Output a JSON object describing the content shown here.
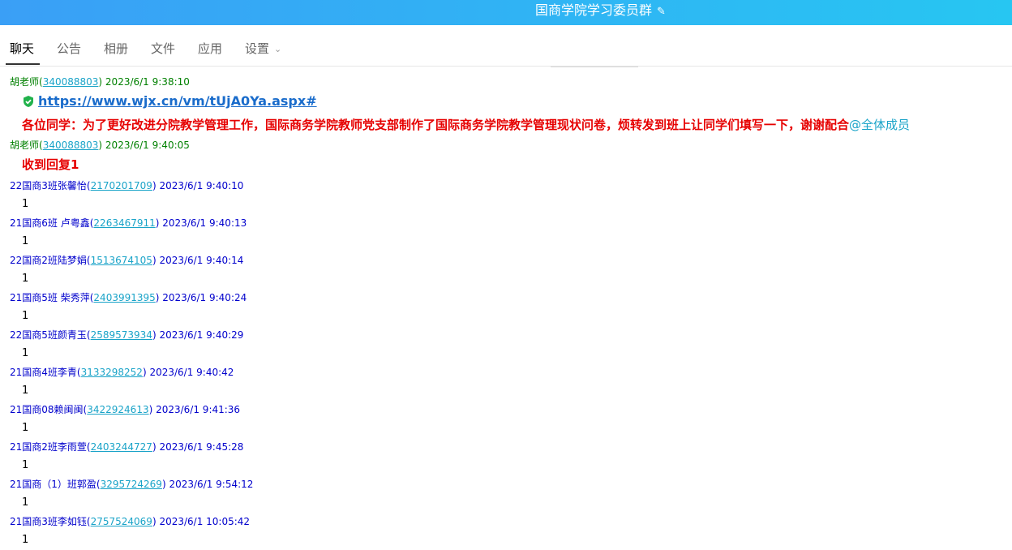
{
  "window": {
    "title": "国商学院学习委员群",
    "edit_icon": "✎"
  },
  "tabs": [
    {
      "label": "聊天"
    },
    {
      "label": "公告"
    },
    {
      "label": "相册"
    },
    {
      "label": "文件"
    },
    {
      "label": "应用"
    },
    {
      "label": "设置",
      "chevron": "⌄"
    }
  ],
  "colors": {
    "titlebar_start": "#3a9ff6",
    "titlebar_end": "#27c6f2",
    "teacher": "#008000",
    "student": "#0000cc",
    "alert": "#e60000",
    "link": "#1a6ccb",
    "uid": "#19a3c8",
    "shield": "#21b24b"
  },
  "messages": [
    {
      "sender": "胡老师",
      "uid": "340088803",
      "time": "2023/6/1 9:38:10",
      "link": "https://www.wjx.cn/vm/tUjA0Ya.aspx#",
      "text": "各位同学：为了更好改进分院教学管理工作，国际商务学院教师党支部制作了国际商务学院教学管理现状问卷，烦转发到班上让同学们填写一下，谢谢配合",
      "mention": "@全体成员"
    },
    {
      "sender": "胡老师",
      "uid": "340088803",
      "time": "2023/6/1 9:40:05",
      "text": "收到回复1"
    },
    {
      "sender": "22国商3班张馨怡",
      "uid": "2170201709",
      "time": "2023/6/1 9:40:10",
      "text": "1"
    },
    {
      "sender": "21国商6班 卢粤鑫",
      "uid": "2263467911",
      "time": "2023/6/1 9:40:13",
      "text": "1"
    },
    {
      "sender": "22国商2班陆梦娟",
      "uid": "1513674105",
      "time": "2023/6/1 9:40:14",
      "text": "1"
    },
    {
      "sender": "21国商5班 柴秀萍",
      "uid": "2403991395",
      "time": "2023/6/1 9:40:24",
      "text": "1"
    },
    {
      "sender": "22国商5班颜青玉",
      "uid": "2589573934",
      "time": "2023/6/1 9:40:29",
      "text": "1"
    },
    {
      "sender": "21国商4班李青",
      "uid": "3133298252",
      "time": "2023/6/1 9:40:42",
      "text": "1"
    },
    {
      "sender": "21国商08赖闽闽",
      "uid": "3422924613",
      "time": "2023/6/1 9:41:36",
      "text": "1"
    },
    {
      "sender": "21国商2班李雨萱",
      "uid": "2403244727",
      "time": "2023/6/1 9:45:28",
      "text": "1"
    },
    {
      "sender": "21国商（1）班郭盈",
      "uid": "3295724269",
      "time": "2023/6/1 9:54:12",
      "text": "1"
    },
    {
      "sender": "21国商3班李如钰",
      "uid": "2757524069",
      "time": "2023/6/1 10:05:42",
      "text": "1"
    }
  ]
}
